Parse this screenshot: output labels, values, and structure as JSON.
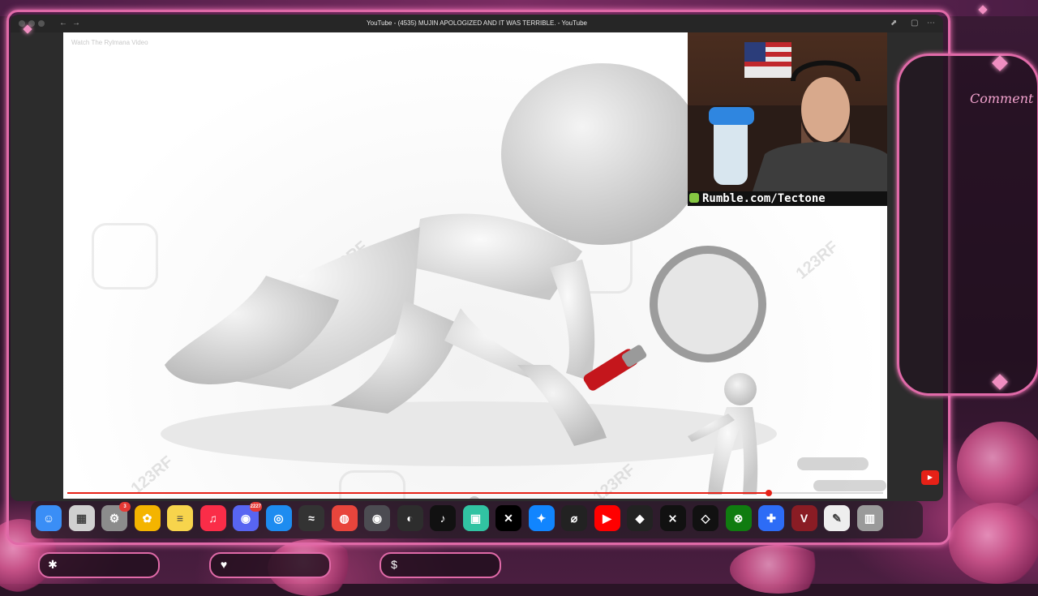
{
  "window": {
    "title": "YouTube - (4535) MUJIN APOLOGIZED AND IT WAS TERRIBLE. - YouTube"
  },
  "video": {
    "overlay_title": "Watch The Rylmana Video",
    "watermark_text": "123RF",
    "progress": 0.86
  },
  "webcam": {
    "label": "Rumble.com/Tectone"
  },
  "dock": {
    "apps": [
      {
        "name": "Finder",
        "icon": "finder-icon",
        "color": "#3a8ef6"
      },
      {
        "name": "Launchpad",
        "icon": "launchpad-icon",
        "color": "#d0d0d0"
      },
      {
        "name": "System Settings",
        "icon": "settings-icon",
        "color": "#8c8c8c",
        "badge": "3"
      },
      {
        "name": "Photos",
        "icon": "photos-icon",
        "color": "#f4b400"
      },
      {
        "name": "Notes",
        "icon": "notes-icon",
        "color": "#f7d44c"
      },
      {
        "name": "Music",
        "icon": "music-icon",
        "color": "#fa2d48"
      },
      {
        "name": "Discord",
        "icon": "discord-icon",
        "color": "#5865f2",
        "badge": "2227"
      },
      {
        "name": "Safari",
        "icon": "safari-icon",
        "color": "#1d8cf0"
      },
      {
        "name": "Waves",
        "icon": "waves-icon",
        "color": "#333333"
      },
      {
        "name": "Chrome",
        "icon": "chrome-icon",
        "color": "#e8453c"
      },
      {
        "name": "Discord PTB",
        "icon": "discord-ptb-icon",
        "color": "#4c4c52"
      },
      {
        "name": "OBS",
        "icon": "obs-icon",
        "color": "#2d2d2d"
      },
      {
        "name": "TikTok",
        "icon": "tiktok-icon",
        "color": "#111111"
      },
      {
        "name": "Streamlabs",
        "icon": "streamlabs-icon",
        "color": "#31c3a2"
      },
      {
        "name": "X",
        "icon": "x-icon",
        "color": "#000000"
      },
      {
        "name": "Bluesky",
        "icon": "bluesky-icon",
        "color": "#1185fe"
      },
      {
        "name": "Proton",
        "icon": "proton-icon",
        "color": "#222222"
      },
      {
        "name": "YouTube",
        "icon": "youtube-icon",
        "color": "#ff0000"
      },
      {
        "name": "Roblox",
        "icon": "roblox-icon",
        "color": "#222222"
      },
      {
        "name": "CapCut",
        "icon": "capcut-icon",
        "color": "#111111"
      },
      {
        "name": "Tidal",
        "icon": "tidal-icon",
        "color": "#111111"
      },
      {
        "name": "Xbox",
        "icon": "xbox-icon",
        "color": "#107c10"
      },
      {
        "name": "Helper",
        "icon": "plus-app-icon",
        "color": "#2d6cf6"
      },
      {
        "name": "Vicious",
        "icon": "vc-icon",
        "color": "#8a1c24"
      },
      {
        "name": "TextEdit",
        "icon": "textedit-icon",
        "color": "#eeeeee"
      },
      {
        "name": "Trash",
        "icon": "trash-icon",
        "color": "#9a9a9a"
      }
    ]
  },
  "overlay": {
    "comment_label": "Comment",
    "bottom_pills": [
      {
        "icon": "star-icon",
        "glyph": "✱"
      },
      {
        "icon": "heart-icon",
        "glyph": "♥"
      },
      {
        "icon": "dollar-icon",
        "glyph": "$"
      }
    ]
  },
  "colors": {
    "accent_pink": "#e06aa8",
    "progress_red": "#e62117"
  }
}
